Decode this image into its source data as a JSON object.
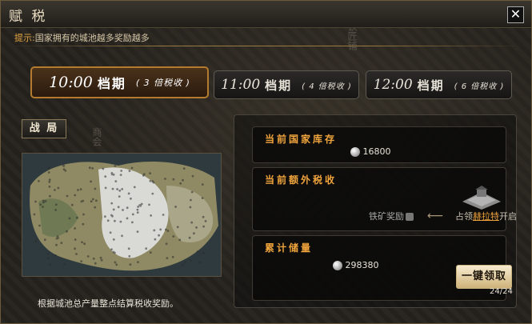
{
  "window": {
    "title": "赋 税",
    "close_glyph": "✕"
  },
  "hint": {
    "label": "提示:",
    "text": "国家拥有的城池越多奖励越多"
  },
  "tabs": [
    {
      "time": "10:00",
      "word": "档期",
      "sub": "( 3 倍税收 )",
      "active": true
    },
    {
      "time": "11:00",
      "word": "档期",
      "sub": "( 4 倍税收 )",
      "active": false
    },
    {
      "time": "12:00",
      "word": "档期",
      "sub": "( 6 倍税收 )",
      "active": false
    }
  ],
  "map_section": {
    "button_label": "战 局",
    "note": "根据城池总产量整点结算税收奖励。"
  },
  "national_stock": {
    "title": "当前国家库存",
    "value": "16800",
    "icon": "silver-coin-icon"
  },
  "extra_tax": {
    "title": "当前额外税收",
    "iron_reward": "铁矿奖励",
    "occupy_prefix": "占领",
    "occupy_link": "赫拉特",
    "occupy_suffix": "开启",
    "icon": "fortress-building-icon"
  },
  "accumulated": {
    "title": "累计储量",
    "value": "298380",
    "icon": "silver-coin-icon",
    "button_label": "一键领取",
    "count": "24/24"
  },
  "colors": {
    "accent": "#f0a43c",
    "active_border": "#b47a2e",
    "hint_label": "#e0a440"
  }
}
